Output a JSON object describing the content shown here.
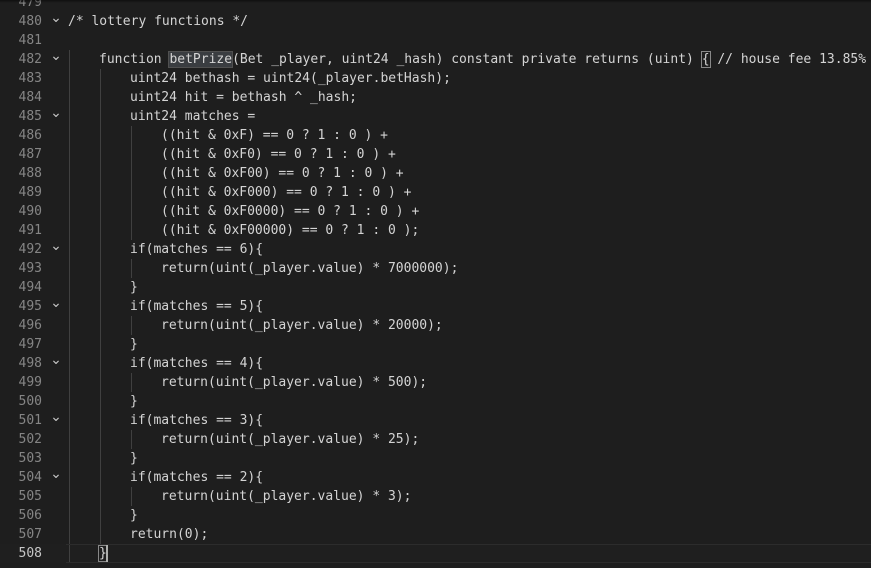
{
  "editor": {
    "language": "solidity",
    "current_line": 508,
    "selected_word": "betPrize",
    "colors": {
      "background": "#1e1e1e",
      "text": "#d4d4d4",
      "line_number": "#858585",
      "current_line_number": "#c6c6c6",
      "indent_guide": "#404040",
      "word_highlight": "#3a3d41"
    },
    "fold_icon": "chevron-down-icon",
    "lines": [
      {
        "num": "479",
        "indent": 0,
        "text": "",
        "fold": false
      },
      {
        "num": "480",
        "indent": 0,
        "text": "/* lottery functions */",
        "fold": true
      },
      {
        "num": "481",
        "indent": 0,
        "text": "",
        "fold": false
      },
      {
        "num": "482",
        "indent": 1,
        "text": "function betPrize(Bet _player, uint24 _hash) constant private returns (uint) { // house fee 13.85%",
        "fold": true
      },
      {
        "num": "483",
        "indent": 2,
        "text": "uint24 bethash = uint24(_player.betHash);",
        "fold": false
      },
      {
        "num": "484",
        "indent": 2,
        "text": "uint24 hit = bethash ^ _hash;",
        "fold": false
      },
      {
        "num": "485",
        "indent": 2,
        "text": "uint24 matches =",
        "fold": true
      },
      {
        "num": "486",
        "indent": 3,
        "text": "((hit & 0xF) == 0 ? 1 : 0 ) +",
        "fold": false
      },
      {
        "num": "487",
        "indent": 3,
        "text": "((hit & 0xF0) == 0 ? 1 : 0 ) +",
        "fold": false
      },
      {
        "num": "488",
        "indent": 3,
        "text": "((hit & 0xF00) == 0 ? 1 : 0 ) +",
        "fold": false
      },
      {
        "num": "489",
        "indent": 3,
        "text": "((hit & 0xF000) == 0 ? 1 : 0 ) +",
        "fold": false
      },
      {
        "num": "490",
        "indent": 3,
        "text": "((hit & 0xF0000) == 0 ? 1 : 0 ) +",
        "fold": false
      },
      {
        "num": "491",
        "indent": 3,
        "text": "((hit & 0xF00000) == 0 ? 1 : 0 );",
        "fold": false
      },
      {
        "num": "492",
        "indent": 2,
        "text": "if(matches == 6){",
        "fold": true
      },
      {
        "num": "493",
        "indent": 3,
        "text": "return(uint(_player.value) * 7000000);",
        "fold": false
      },
      {
        "num": "494",
        "indent": 2,
        "text": "}",
        "fold": false
      },
      {
        "num": "495",
        "indent": 2,
        "text": "if(matches == 5){",
        "fold": true
      },
      {
        "num": "496",
        "indent": 3,
        "text": "return(uint(_player.value) * 20000);",
        "fold": false
      },
      {
        "num": "497",
        "indent": 2,
        "text": "}",
        "fold": false
      },
      {
        "num": "498",
        "indent": 2,
        "text": "if(matches == 4){",
        "fold": true
      },
      {
        "num": "499",
        "indent": 3,
        "text": "return(uint(_player.value) * 500);",
        "fold": false
      },
      {
        "num": "500",
        "indent": 2,
        "text": "}",
        "fold": false
      },
      {
        "num": "501",
        "indent": 2,
        "text": "if(matches == 3){",
        "fold": true
      },
      {
        "num": "502",
        "indent": 3,
        "text": "return(uint(_player.value) * 25);",
        "fold": false
      },
      {
        "num": "503",
        "indent": 2,
        "text": "}",
        "fold": false
      },
      {
        "num": "504",
        "indent": 2,
        "text": "if(matches == 2){",
        "fold": true
      },
      {
        "num": "505",
        "indent": 3,
        "text": "return(uint(_player.value) * 3);",
        "fold": false
      },
      {
        "num": "506",
        "indent": 2,
        "text": "}",
        "fold": false
      },
      {
        "num": "507",
        "indent": 2,
        "text": "return(0);",
        "fold": false
      },
      {
        "num": "508",
        "indent": 1,
        "text": "}",
        "fold": false
      }
    ]
  }
}
